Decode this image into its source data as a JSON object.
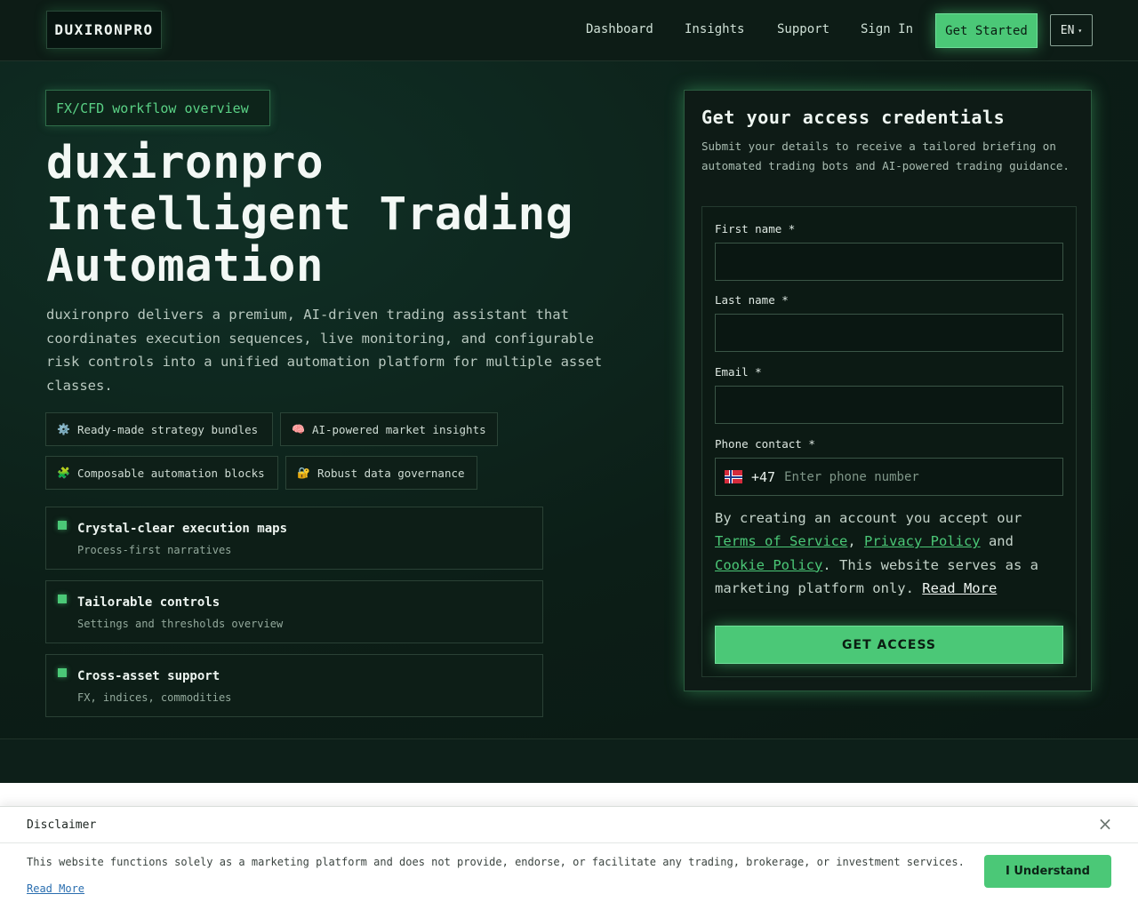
{
  "nav": {
    "logo": "DUXIRONPRO",
    "links": [
      "Dashboard",
      "Insights",
      "Support",
      "Sign In"
    ],
    "cta": "Get Started",
    "language": "EN",
    "language_caret": "▾"
  },
  "hero": {
    "pill": "FX/CFD workflow overview",
    "title_lines": [
      "duxironpro",
      "Intelligent Trading",
      "Automation"
    ],
    "lead": "duxironpro delivers a premium, AI-driven trading assistant that coordinates execution sequences, live monitoring, and configurable risk controls into a unified automation platform for multiple asset classes.",
    "tags": [
      {
        "icon": "⚙️",
        "icon_name": "gear-icon",
        "label": "Ready-made strategy bundles"
      },
      {
        "icon": "🧠",
        "icon_name": "brain-icon",
        "label": "AI-powered market insights"
      },
      {
        "icon": "🧩",
        "icon_name": "puzzle-icon",
        "label": "Composable automation blocks"
      },
      {
        "icon": "🔐",
        "icon_name": "lock-icon",
        "label": "Robust data governance"
      }
    ],
    "features": [
      {
        "title": "Crystal-clear execution maps",
        "subtitle": "Process-first narratives"
      },
      {
        "title": "Tailorable controls",
        "subtitle": "Settings and thresholds overview"
      },
      {
        "title": "Cross-asset support",
        "subtitle": "FX, indices, commodities"
      }
    ]
  },
  "form": {
    "title": "Get your access credentials",
    "subtitle": "Submit your details to receive a tailored briefing on automated trading bots and AI-powered trading guidance.",
    "first_name_label": "First name *",
    "last_name_label": "Last name *",
    "email_label": "Email *",
    "phone_label": "Phone contact *",
    "dial_code": "+47",
    "phone_placeholder": "Enter phone number",
    "terms_prefix": "By creating an account you accept our ",
    "terms_link": "Terms of Service",
    "terms_sep": ", ",
    "privacy_link": "Privacy Policy",
    "terms_and": " and ",
    "cookie_link": "Cookie Policy",
    "terms_suffix": ". This website serves as a marketing platform only. ",
    "read_more": "Read More",
    "submit": "GET ACCESS"
  },
  "disclaimer": {
    "title": "Disclaimer",
    "close": "×",
    "text": "This website functions solely as a marketing platform and does not provide, endorse, or facilitate any trading, brokerage, or investment services.",
    "read_more": "Read More",
    "button": "I Understand"
  },
  "colors": {
    "accent": "#4bc877",
    "background": "#0b1813",
    "card_border": "#2a5a3e"
  }
}
